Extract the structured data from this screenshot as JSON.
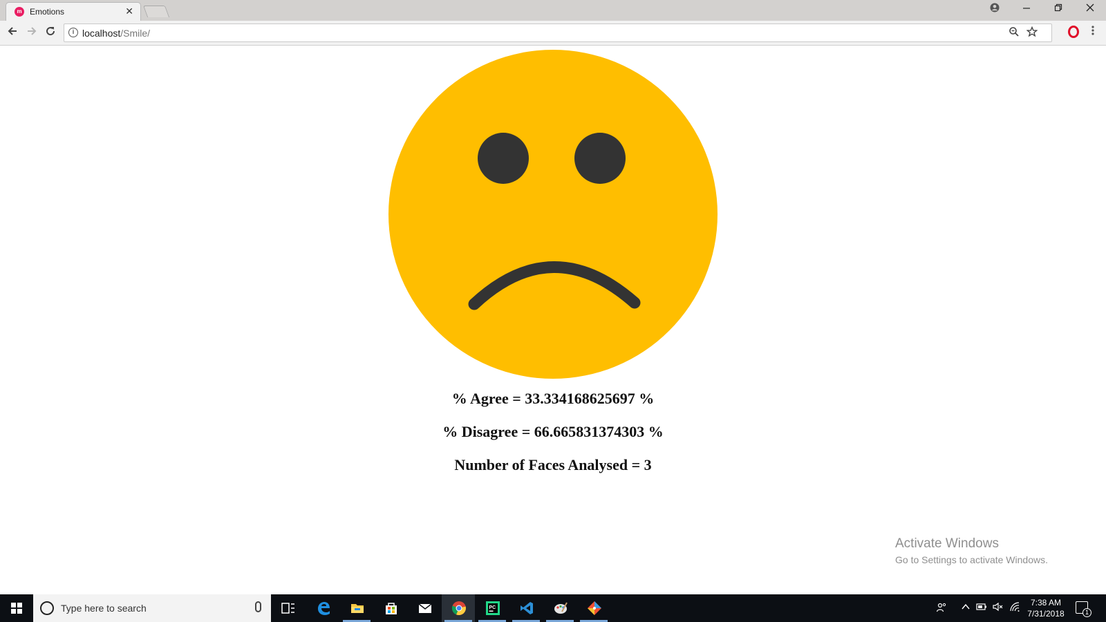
{
  "browser": {
    "tab_title": "Emotions",
    "url_host": "localhost",
    "url_path": "/Smile/"
  },
  "page": {
    "face": {
      "expression": "sad",
      "icon": "sad-face-icon",
      "face_color": "#FFBE00",
      "feature_color": "#333333"
    },
    "stats": {
      "agree_line": "% Agree = 33.334168625697 %",
      "disagree_line": "% Disagree = 66.665831374303 %",
      "faces_line": "Number of Faces Analysed = 3"
    },
    "watermark": {
      "title": "Activate Windows",
      "subtitle": "Go to Settings to activate Windows."
    }
  },
  "taskbar": {
    "search_placeholder": "Type here to search",
    "time": "7:38 AM",
    "date": "7/31/2018",
    "notification_count": "1",
    "pinned_apps": [
      "task-view",
      "edge",
      "file-explorer",
      "store",
      "mail",
      "chrome",
      "pycharm",
      "vscode",
      "paint",
      "git"
    ]
  },
  "colors": {
    "accent_taskbar": "#0c0f14",
    "face_yellow": "#FFBE00"
  }
}
